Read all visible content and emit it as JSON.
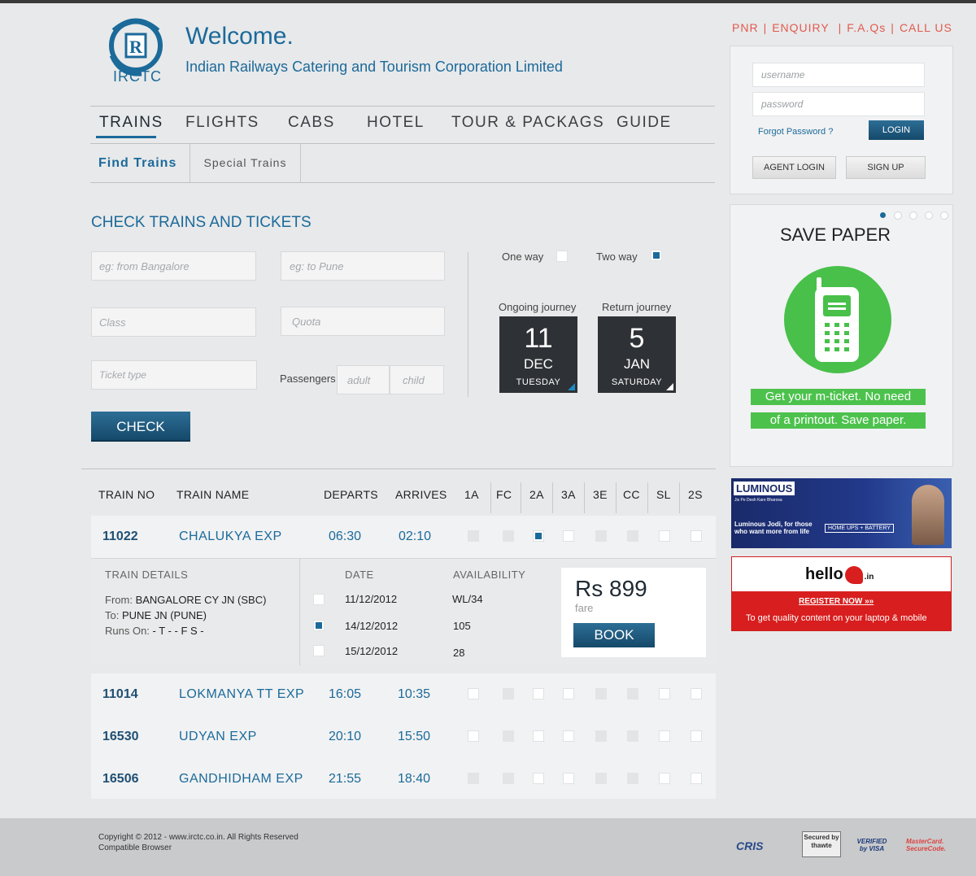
{
  "header": {
    "logo_text": "IRCTC",
    "welcome": "Welcome.",
    "corp_name": "Indian Railways Catering and Tourism Corporation Limited"
  },
  "top_links": [
    "PNR",
    "ENQUIRY",
    "F.A.Qs",
    "CALL US"
  ],
  "nav": {
    "items": [
      "TRAINS",
      "FLIGHTS",
      "CABS",
      "HOTEL",
      "TOUR & PACKAGS",
      "GUIDE"
    ],
    "sub_tabs": [
      "Find Trains",
      "Special Trains"
    ]
  },
  "search": {
    "title": "CHECK TRAINS AND TICKETS",
    "from_placeholder": "eg: from Bangalore",
    "to_placeholder": "eg: to Pune",
    "class_placeholder": "Class",
    "quota_placeholder": "Quota",
    "ticket_type_placeholder": "Ticket type",
    "passengers_label": "Passengers",
    "adult_placeholder": "adult",
    "child_placeholder": "child",
    "one_way": "One way",
    "two_way": "Two way",
    "ongoing_label": "Ongoing journey",
    "return_label": "Return journey",
    "ongoing": {
      "day": "11",
      "month": "DEC",
      "weekday": "TUESDAY"
    },
    "return": {
      "day": "5",
      "month": "JAN",
      "weekday": "SATURDAY"
    },
    "check_button": "CHECK"
  },
  "table": {
    "headers": [
      "TRAIN NO",
      "TRAIN NAME",
      "DEPARTS",
      "ARRIVES",
      "1A",
      "FC",
      "2A",
      "3A",
      "3E",
      "CC",
      "SL",
      "2S"
    ],
    "rows": [
      {
        "no": "11022",
        "name": "CHALUKYA EXP",
        "departs": "06:30",
        "arrives": "02:10"
      },
      {
        "no": "11014",
        "name": "LOKMANYA TT EXP",
        "departs": "16:05",
        "arrives": "10:35"
      },
      {
        "no": "16530",
        "name": "UDYAN EXP",
        "departs": "20:10",
        "arrives": "15:50"
      },
      {
        "no": "16506",
        "name": "GANDHIDHAM EXP",
        "departs": "21:55",
        "arrives": "18:40"
      }
    ]
  },
  "details": {
    "title": "TRAIN DETAILS",
    "from_label": "From:",
    "from_value": "BANGALORE CY JN (SBC)",
    "to_label": "To:",
    "to_value": "PUNE JN (PUNE)",
    "runs_label": "Runs On:",
    "runs_value": "- T - - F S -",
    "date_header": "DATE",
    "avail_header": "AVAILABILITY",
    "dates": [
      {
        "date": "11/12/2012",
        "avail": "WL/34"
      },
      {
        "date": "14/12/2012",
        "avail": "105"
      },
      {
        "date": "15/12/2012",
        "avail": "28"
      }
    ],
    "fare": "Rs 899",
    "fare_label": "fare",
    "book_button": "BOOK"
  },
  "login": {
    "username_placeholder": "username",
    "password_placeholder": "password",
    "forgot": "Forgot Password ?",
    "login_button": "LOGIN",
    "agent_login": "AGENT LOGIN",
    "sign_up": "SIGN UP"
  },
  "promo": {
    "title": "SAVE PAPER",
    "line1": "Get your m-ticket. No need",
    "line2": "of a printout. Save paper."
  },
  "ads": {
    "luminous_brand": "LUMINOUS",
    "luminous_tag": "Jis Pe Desh Kare Bharosa",
    "luminous_line1": "Luminous Jodi, for those",
    "luminous_line2": "who want more from life",
    "luminous_badge": "HOME UPS + BATTERY",
    "hello_brand": "hello",
    "hello_suffix": ".in",
    "hello_cta": "REGISTER NOW",
    "hello_sub": "To get quality content on your laptop & mobile"
  },
  "footer": {
    "copyright": "Copyright © 2012 - www.irctc.co.in. All Rights Reserved",
    "compat": "Compatible Browser",
    "badges": [
      "CRIS",
      "Secured by thawte",
      "VERIFIED by VISA",
      "MasterCard. SecureCode."
    ]
  },
  "colors": {
    "accent": "#1b6a9a",
    "link_red": "#e05a4e",
    "green": "#48c04a"
  }
}
